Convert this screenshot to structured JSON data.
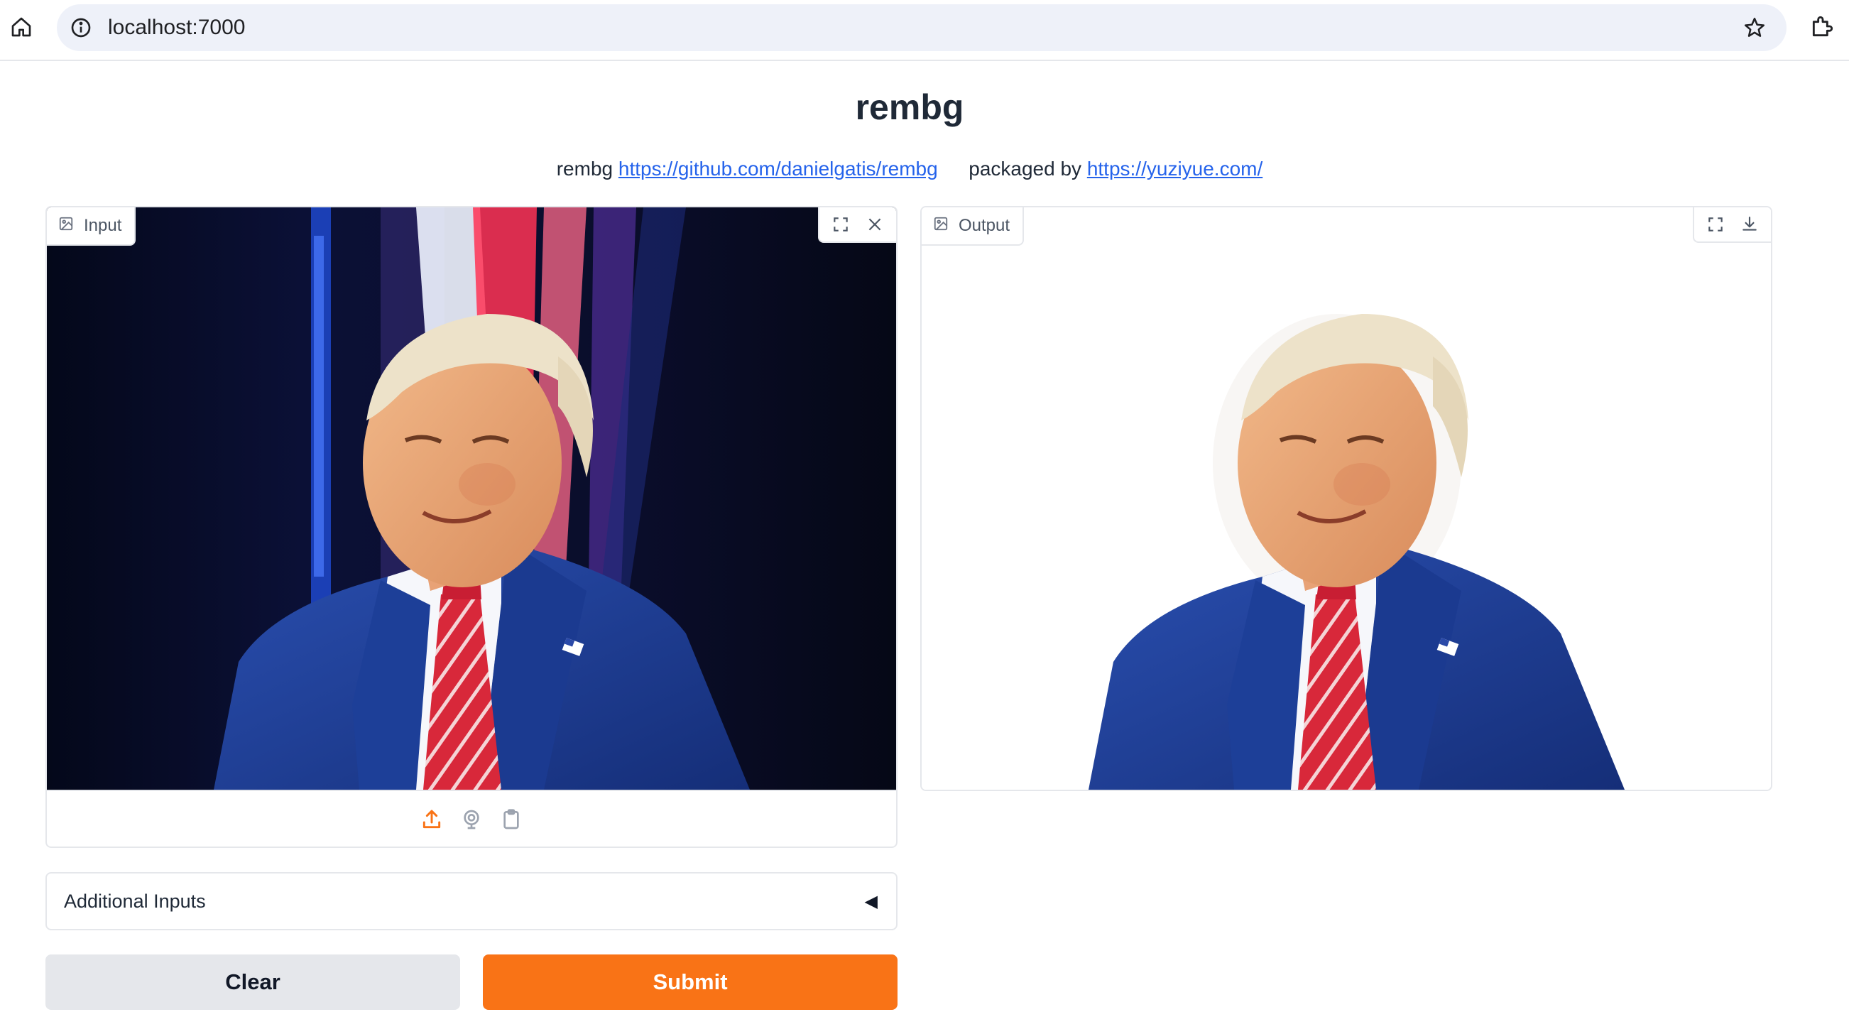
{
  "browser": {
    "url": "localhost:7000"
  },
  "app": {
    "title": "rembg",
    "description": {
      "prefix": "rembg",
      "repo_link": "https://github.com/danielgatis/rembg",
      "packaged_by": "packaged by",
      "site_link": "https://yuziyue.com/"
    }
  },
  "input_panel": {
    "label": "Input"
  },
  "output_panel": {
    "label": "Output"
  },
  "accordion": {
    "label": "Additional Inputs",
    "caret": "◀"
  },
  "buttons": {
    "clear": "Clear",
    "submit": "Submit"
  },
  "colors": {
    "accent": "#f97316",
    "link": "#2563eb",
    "border": "#e5e7eb",
    "suit": "#1f3f8f",
    "tie": "#d8283a",
    "background_dark": "#070b1e"
  }
}
